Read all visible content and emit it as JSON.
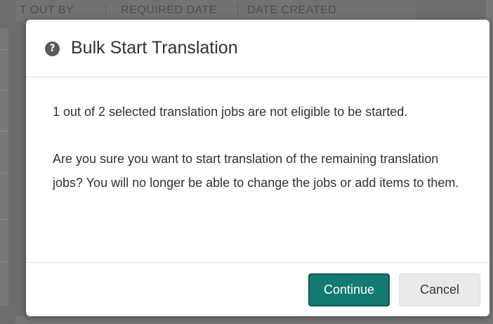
{
  "background": {
    "columns": [
      "T OUT BY",
      "REQUIRED DATE",
      "DATE CREATED"
    ]
  },
  "dialog": {
    "icon": "question-circle-icon",
    "title": "Bulk Start Translation",
    "message_1": "1 out of 2 selected translation jobs are not eligible to be started.",
    "message_2": "Are you sure you want to start translation of the remaining translation jobs? You will no longer be able to change the jobs or add items to them.",
    "continue_label": "Continue",
    "cancel_label": "Cancel"
  },
  "colors": {
    "primary": "#137a70",
    "secondary": "#e9eaeb",
    "overlay": "#6c6c6c"
  }
}
